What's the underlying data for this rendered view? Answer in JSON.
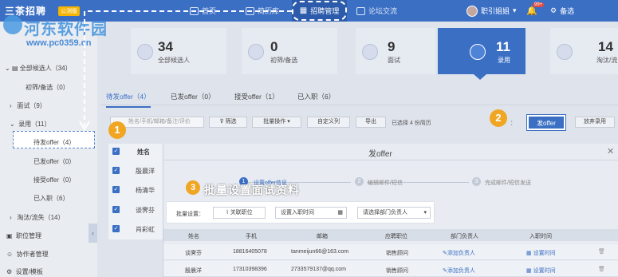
{
  "app": {
    "brand": "三茶招聘",
    "edition_badge": "公测版"
  },
  "topnav": {
    "items": [
      {
        "label": "首页",
        "icon": "home-icon"
      },
      {
        "label": "简历库",
        "icon": "resume-icon"
      },
      {
        "label": "招聘管理",
        "icon": "grid-icon"
      },
      {
        "label": "论坛交流",
        "icon": "forum-icon"
      }
    ],
    "user_name": "职引姐姐",
    "notif_badge": "99+",
    "settings_label": "备选"
  },
  "watermark": {
    "text": "河东软件园",
    "url": "www.pc0359.cn"
  },
  "sidebar": {
    "section": "全部候选人",
    "items": [
      {
        "label": "全部候选人（34）"
      },
      {
        "label": "初筛/备选（0）"
      },
      {
        "label": "面试（9）"
      },
      {
        "label": "录用（11）"
      },
      {
        "label": "待发offer（4）"
      },
      {
        "label": "已发offer（0）"
      },
      {
        "label": "接受offer（0）"
      },
      {
        "label": "已入职（6）"
      },
      {
        "label": "淘汰/流失（14）"
      },
      {
        "label": "职位管理"
      },
      {
        "label": "协作者管理"
      },
      {
        "label": "设置/模板"
      }
    ]
  },
  "stats": [
    {
      "num": "34",
      "label": "全部候选人"
    },
    {
      "num": "0",
      "label": "初筛/备选"
    },
    {
      "num": "9",
      "label": "面试"
    },
    {
      "num": "11",
      "label": "录用"
    },
    {
      "num": "14",
      "label": "淘汰/流"
    }
  ],
  "tabs": [
    "待发offer（4）",
    "已发offer（0）",
    "接受offer（1）",
    "已入职（6）"
  ],
  "toolbar": {
    "search_placeholder": "姓名/手机/邮箱/备注/评价",
    "filter": "筛选",
    "batch_ops": "批量操作",
    "custom_cols": "自定义列",
    "export": "导出",
    "selected_info": "已选择 4 份简历",
    "batch_label": "批量设置：",
    "send_offer": "发offer",
    "give_up": "放弃录用"
  },
  "callouts": {
    "one": "1",
    "two": "2",
    "three": "3",
    "batch_title": "批量设置面试资料"
  },
  "candidate_list": {
    "header": "姓名",
    "names": [
      "殷晨洋",
      "杨清华",
      "谈霁芬",
      "肖彩虹"
    ]
  },
  "modal": {
    "title": "发offer",
    "steps": [
      {
        "num": "1",
        "label": "设置offer信息"
      },
      {
        "num": "2",
        "label": "编辑邮件/短信"
      },
      {
        "num": "3",
        "label": "完成邮件/短信发送"
      }
    ],
    "batch": {
      "label": "批量设置：",
      "position_btn": "关联职位",
      "entry_time": "设置入职时间",
      "dept_select": "请选择部门负责人"
    },
    "columns": [
      "姓名",
      "手机",
      "邮箱",
      "应聘职位",
      "部门负责人",
      "入职时间"
    ],
    "rows": [
      {
        "name": "谈霁芬",
        "phone": "18816405078",
        "email": "tanmeijun66@163.com",
        "position": "销售顾问",
        "dept": "添加负责人",
        "time": "设置时间"
      },
      {
        "name": "殷晨洋",
        "phone": "17310398396",
        "email": "2733579137@qq.com",
        "position": "销售顾问",
        "dept": "添加负责人",
        "time": "设置时间"
      }
    ]
  }
}
